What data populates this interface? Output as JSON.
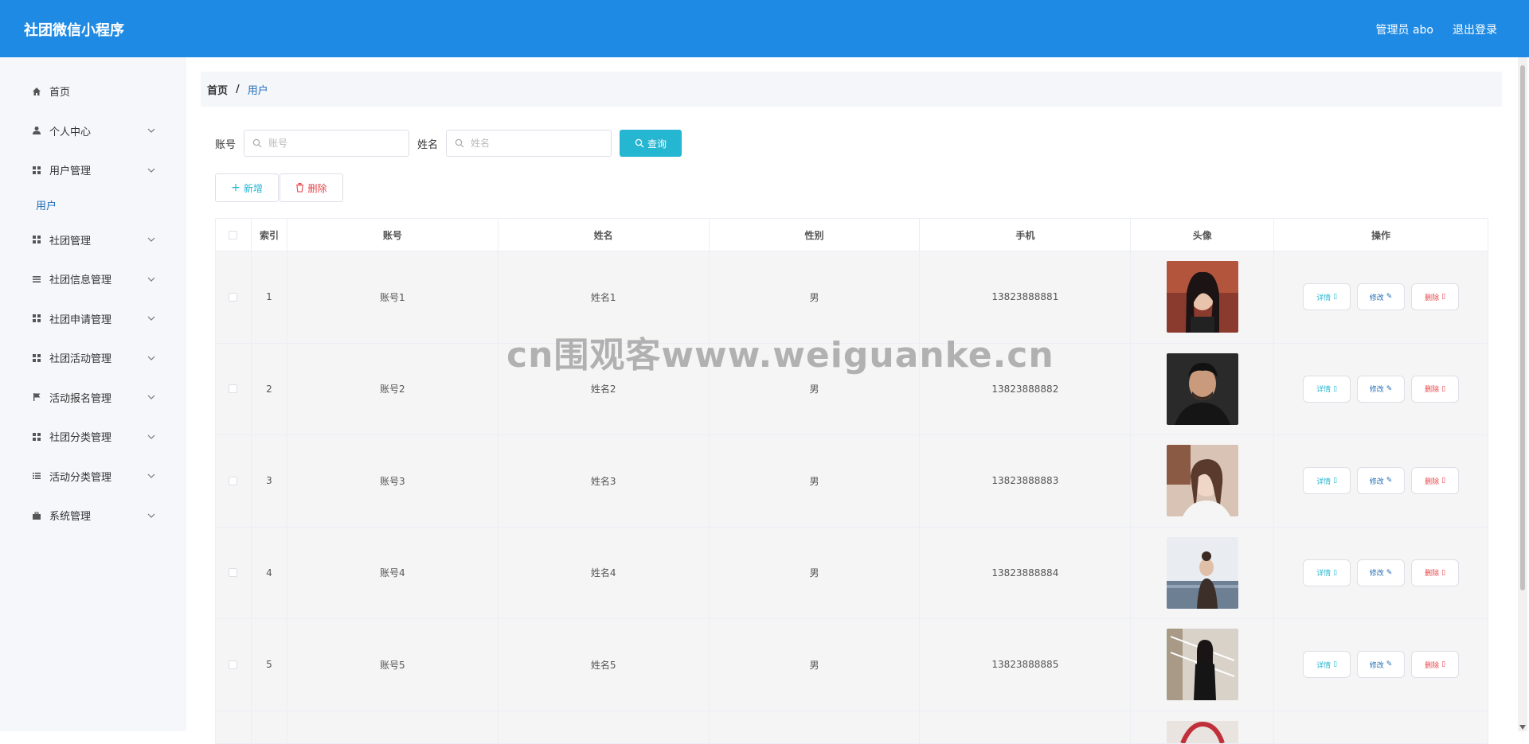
{
  "header": {
    "title": "社团微信小程序",
    "admin": "管理员 abo",
    "logout": "退出登录",
    "bg_color": "#1f8ae3"
  },
  "sidebar": {
    "items": [
      {
        "label": "首页",
        "icon": "home-icon",
        "expandable": false
      },
      {
        "label": "个人中心",
        "icon": "user-icon",
        "expandable": true
      },
      {
        "label": "用户管理",
        "icon": "grid-icon",
        "expandable": true,
        "sub": [
          "用户"
        ]
      },
      {
        "label": "社团管理",
        "icon": "grid-icon",
        "expandable": true
      },
      {
        "label": "社团信息管理",
        "icon": "list-icon",
        "expandable": true
      },
      {
        "label": "社团申请管理",
        "icon": "grid-icon",
        "expandable": true
      },
      {
        "label": "社团活动管理",
        "icon": "grid-icon",
        "expandable": true
      },
      {
        "label": "活动报名管理",
        "icon": "flag-icon",
        "expandable": true
      },
      {
        "label": "社团分类管理",
        "icon": "grid-icon",
        "expandable": true
      },
      {
        "label": "活动分类管理",
        "icon": "list-icon",
        "expandable": true
      },
      {
        "label": "系统管理",
        "icon": "briefcase-icon",
        "expandable": true
      }
    ]
  },
  "breadcrumb": {
    "home": "首页",
    "sep": "/",
    "current": "用户"
  },
  "search": {
    "account_label": "账号",
    "account_placeholder": "账号",
    "name_label": "姓名",
    "name_placeholder": "姓名",
    "query_button": "查询"
  },
  "actions": {
    "add": "新增",
    "delete": "删除"
  },
  "table": {
    "headers": {
      "index": "索引",
      "account": "账号",
      "name": "姓名",
      "gender": "性别",
      "phone": "手机",
      "avatar": "头像",
      "ops": "操作"
    },
    "rows": [
      {
        "index": "1",
        "account": "账号1",
        "name": "姓名1",
        "gender": "男",
        "phone": "13823888881"
      },
      {
        "index": "2",
        "account": "账号2",
        "name": "姓名2",
        "gender": "男",
        "phone": "13823888882"
      },
      {
        "index": "3",
        "account": "账号3",
        "name": "姓名3",
        "gender": "男",
        "phone": "13823888883"
      },
      {
        "index": "4",
        "account": "账号4",
        "name": "姓名4",
        "gender": "男",
        "phone": "13823888884"
      },
      {
        "index": "5",
        "account": "账号5",
        "name": "姓名5",
        "gender": "男",
        "phone": "13823888885"
      }
    ],
    "op_labels": {
      "detail": "详情",
      "edit": "修改",
      "delete": "删除"
    }
  },
  "watermark": "cn围观客www.weiguanke.cn"
}
